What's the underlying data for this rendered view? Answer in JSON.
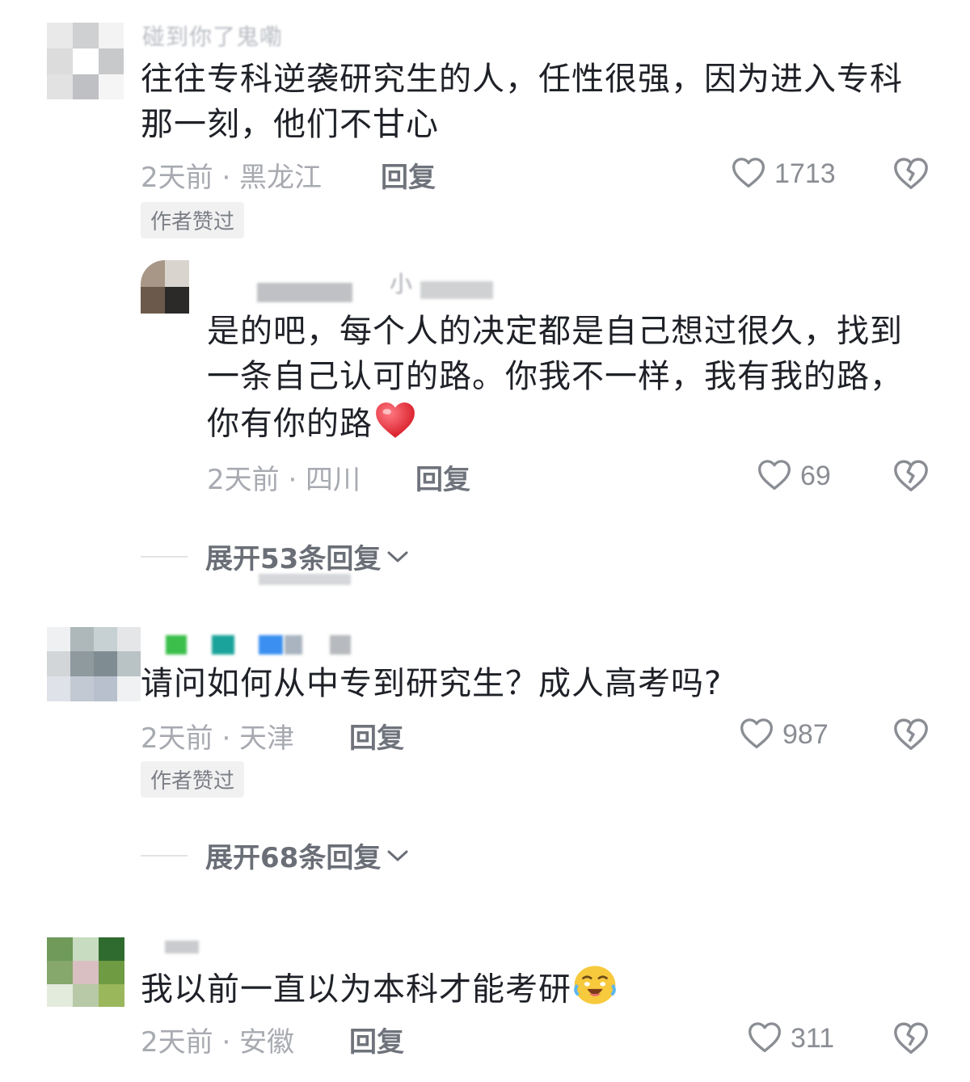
{
  "comments": [
    {
      "username": "碰到你了鬼嘞",
      "text": "往往专科逆袭研究生的人，任性很强，因为进入专科那一刻，他们不甘心",
      "time": "2天前 · 黑龙江",
      "reply_label": "回复",
      "likes": "1713",
      "author_liked": "作者赞过",
      "replies": [
        {
          "username": "小",
          "text": "是的吧，每个人的决定都是自己想过很久，找到一条自己认可的路。你我不一样，我有我的路，你有你的路",
          "time": "2天前 · 四川",
          "reply_label": "回复",
          "likes": "69"
        }
      ],
      "expand_label": "展开53条回复"
    },
    {
      "username": "",
      "text": "请问如何从中专到研究生？成人高考吗?",
      "time": "2天前 · 天津",
      "reply_label": "回复",
      "likes": "987",
      "author_liked": "作者赞过",
      "expand_label": "展开68条回复"
    },
    {
      "username": "",
      "text": "我以前一直以为本科才能考研",
      "time": "2天前 · 安徽",
      "reply_label": "回复",
      "likes": "311"
    }
  ],
  "icons": {
    "like": "heart-outline-icon",
    "dislike": "broken-heart-icon",
    "expand": "chevron-down-icon",
    "emoji_heart": "red-heart-emoji",
    "emoji_cry": "crying-laughing-emoji"
  },
  "colors": {
    "text": "#1f2128",
    "meta": "#a7aab0",
    "reply": "#6f737b",
    "heart_emoji": "#e8323c"
  }
}
